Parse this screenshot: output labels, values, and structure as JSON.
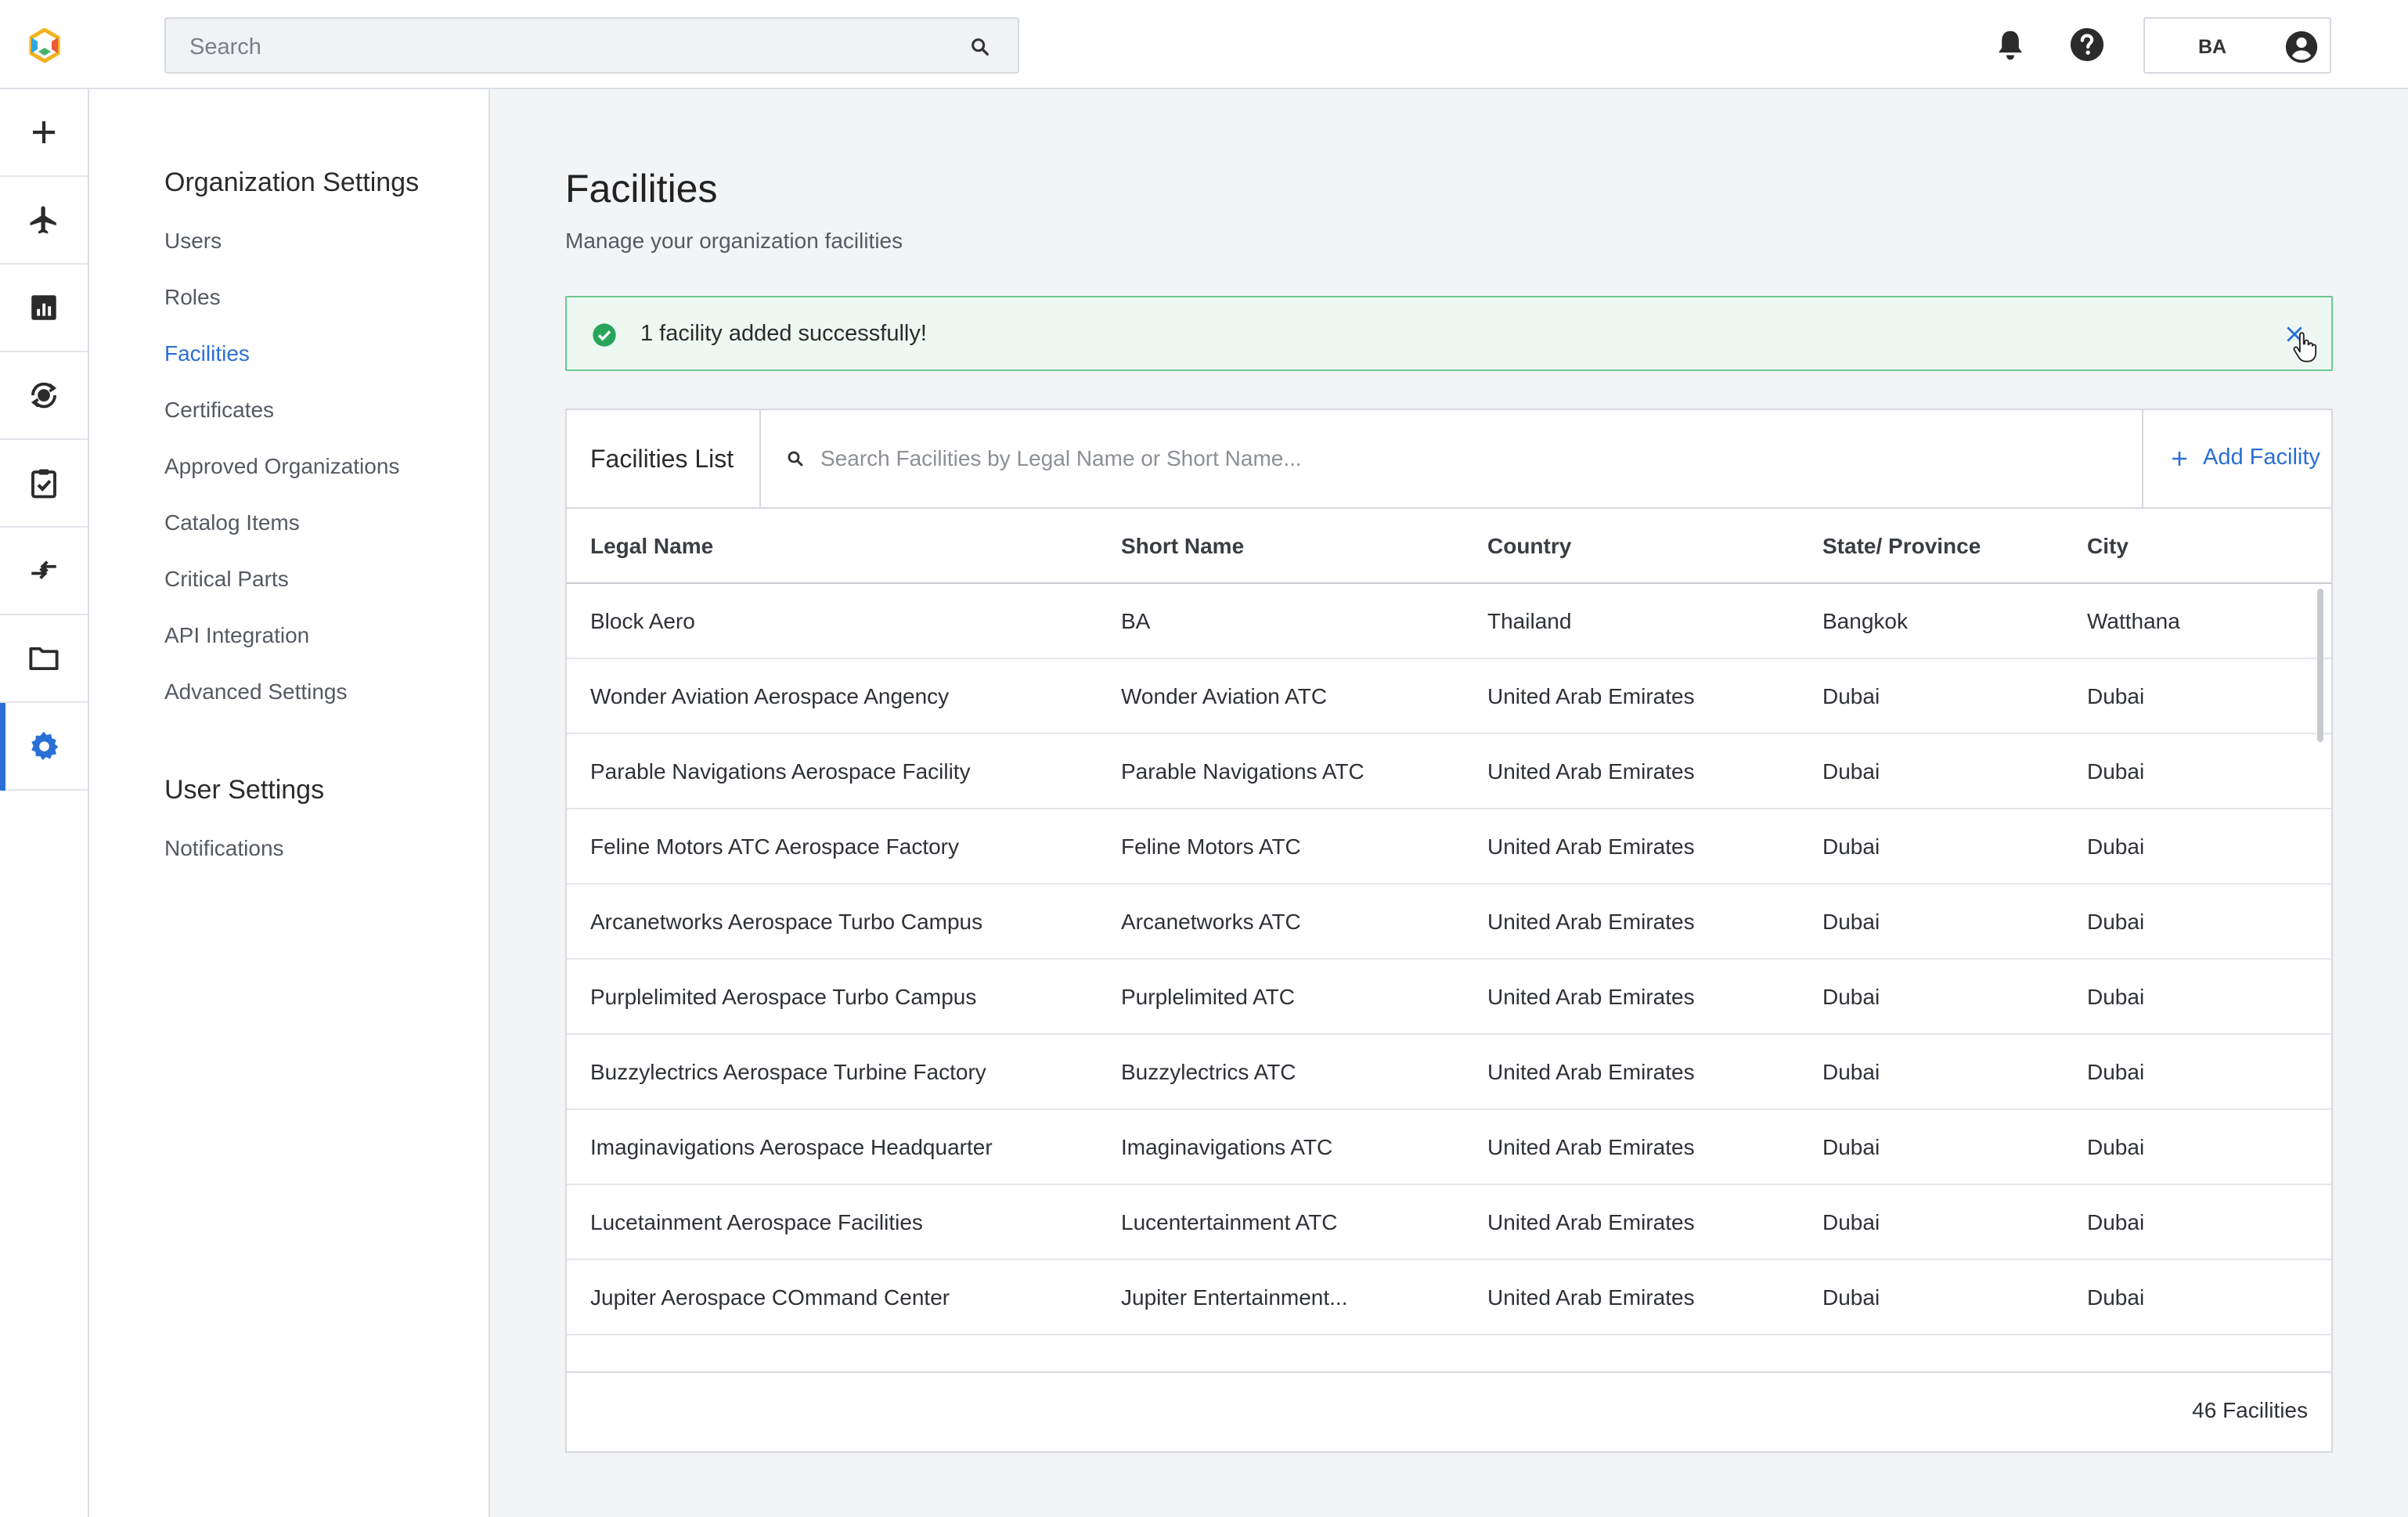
{
  "topbar": {
    "search_placeholder": "Search",
    "user_initials": "BA"
  },
  "rail": {
    "icons": [
      "add-icon",
      "airplane-icon",
      "analytics-icon",
      "sync-globe-icon",
      "clipboard-check-icon",
      "transfer-icon",
      "folder-icon",
      "settings-icon"
    ],
    "active": "settings-icon"
  },
  "settings_nav": {
    "org_heading": "Organization Settings",
    "org_links": [
      "Users",
      "Roles",
      "Facilities",
      "Certificates",
      "Approved Organizations",
      "Catalog Items",
      "Critical Parts",
      "API Integration",
      "Advanced Settings"
    ],
    "user_heading": "User Settings",
    "user_links": [
      "Notifications"
    ],
    "active": "Facilities"
  },
  "page": {
    "title": "Facilities",
    "subtitle": "Manage your organization facilities"
  },
  "toast": {
    "message": "1 facility added successfully!"
  },
  "facilities": {
    "list_title": "Facilities List",
    "search_placeholder": "Search Facilities by Legal Name or Short Name...",
    "add_label": "Add Facility",
    "columns": [
      "Legal Name",
      "Short Name",
      "Country",
      "State/ Province",
      "City"
    ],
    "rows": [
      [
        "Block Aero",
        "BA",
        "Thailand",
        "Bangkok",
        "Watthana"
      ],
      [
        "Wonder Aviation Aerospace Angency",
        "Wonder Aviation ATC",
        "United Arab Emirates",
        "Dubai",
        "Dubai"
      ],
      [
        "Parable Navigations Aerospace Facility",
        "Parable Navigations ATC",
        "United Arab Emirates",
        "Dubai",
        "Dubai"
      ],
      [
        "Feline Motors ATC Aerospace Factory",
        "Feline Motors ATC",
        "United Arab Emirates",
        "Dubai",
        "Dubai"
      ],
      [
        "Arcanetworks Aerospace Turbo Campus",
        "Arcanetworks ATC",
        "United Arab Emirates",
        "Dubai",
        "Dubai"
      ],
      [
        "Purplelimited Aerospace Turbo Campus",
        "Purplelimited ATC",
        "United Arab Emirates",
        "Dubai",
        "Dubai"
      ],
      [
        "Buzzylectrics Aerospace Turbine Factory",
        "Buzzylectrics ATC",
        "United Arab Emirates",
        "Dubai",
        "Dubai"
      ],
      [
        "Imaginavigations Aerospace Headquarter",
        "Imaginavigations ATC",
        "United Arab Emirates",
        "Dubai",
        "Dubai"
      ],
      [
        "Lucetainment Aerospace Facilities",
        "Lucentertainment ATC",
        "United Arab Emirates",
        "Dubai",
        "Dubai"
      ],
      [
        "Jupiter Aerospace COmmand Center",
        "Jupiter Entertainment...",
        "United Arab Emirates",
        "Dubai",
        "Dubai"
      ]
    ],
    "count_label": "46 Facilities"
  },
  "colors": {
    "accent": "#2a6fd6",
    "success": "#27a55a",
    "toast_bg": "#eef8f2"
  }
}
